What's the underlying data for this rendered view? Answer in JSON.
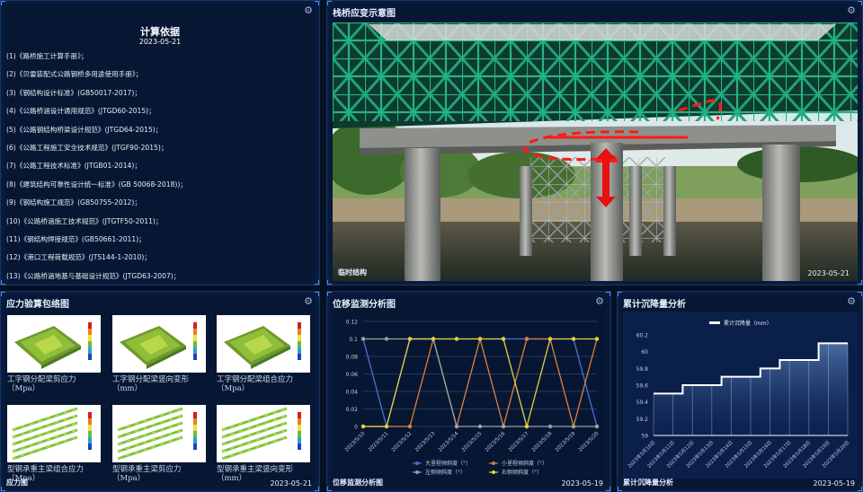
{
  "basis": {
    "title": "计算依据",
    "date": "2023-05-21",
    "items": [
      "(1)《路桥施工计算手册》；",
      "(2)《贝雷装配式公路钢桥多用途使用手册》；",
      "(3)《钢结构设计标准》(GB50017-2017)；",
      "(4)《公路桥涵设计通用规范》(JTGD60-2015)；",
      "(5)《公路钢结构桥梁设计规范》(JTGD64-2015)；",
      "(6)《公路工程施工安全技术规范》(JTGF90-2015)；",
      "(7)《公路工程技术标准》(JTGB01-2014)；",
      "(8)《建筑结构可靠性设计统一标准》(GB 50068-2018))；",
      "(9)《钢结构施工规范》(GB50755-2012)；",
      "(10)《公路桥涵施工技术规范》(JTGTF50-2011)；",
      "(11)《钢结构焊接规范》(GB50661-2011)；",
      "(12)《港口工程荷载规范》(JTS144-1-2010)；",
      "(13)《公路桥涵地基与基础设计规范》(JTGD63-2007)；"
    ]
  },
  "scheme": {
    "title": "栈桥应变示意图",
    "footer_label": "临时结构",
    "date": "2023-05-21",
    "colors": {
      "truss": "#1fa37a",
      "arrow": "#ff1a1a"
    }
  },
  "stress": {
    "title": "应力验算包络图",
    "footer_label": "应力图",
    "date": "2023-05-21",
    "thumbs": [
      {
        "caption_line1": "工字钢分配梁剪应力",
        "caption_line2": "（Mpa）",
        "style": "plate"
      },
      {
        "caption_line1": "工字钢分配梁竖向变形",
        "caption_line2": "（mm）",
        "style": "plate"
      },
      {
        "caption_line1": "工字钢分配梁组合应力",
        "caption_line2": "（Mpa）",
        "style": "plate"
      },
      {
        "caption_line1": "型钢承重主梁组合应力",
        "caption_line2": "（Mpa）",
        "style": "beams"
      },
      {
        "caption_line1": "型钢承重主梁剪应力",
        "caption_line2": "（Mpa）",
        "style": "beams"
      },
      {
        "caption_line1": "型钢承重主梁竖向变形",
        "caption_line2": "（mm）",
        "style": "beams"
      }
    ]
  },
  "displacement": {
    "title": "位移监测分析图",
    "footer_label": "位移监测分析图",
    "date": "2023-05-19",
    "chart_data": {
      "type": "line",
      "x": [
        "2023/5/10",
        "2023/5/11",
        "2023/5/12",
        "2023/5/13",
        "2023/5/14",
        "2023/5/15",
        "2023/5/16",
        "2023/5/17",
        "2023/5/18",
        "2023/5/19",
        "2023/5/20"
      ],
      "ylim": [
        0,
        0.12
      ],
      "yticks": [
        0,
        0.02,
        0.04,
        0.06,
        0.08,
        0.1,
        0.12
      ],
      "grid": true,
      "legend_position": "bottom",
      "series": [
        {
          "name": "大里程倾斜度（°）",
          "color": "#4a6fd8",
          "values": [
            0.1,
            0,
            0.1,
            0.1,
            0.1,
            0.1,
            0.1,
            0.1,
            0.1,
            0.1,
            0
          ]
        },
        {
          "name": "小里程倾斜度（°）",
          "color": "#e0803a",
          "values": [
            0,
            0,
            0,
            0.1,
            0,
            0.1,
            0,
            0.1,
            0.1,
            0,
            0.1
          ]
        },
        {
          "name": "左侧倾斜度（°）",
          "color": "#a0a0a0",
          "values": [
            0.1,
            0.1,
            0.1,
            0.1,
            0,
            0,
            0,
            0,
            0,
            0,
            0
          ]
        },
        {
          "name": "右侧倾斜度（°）",
          "color": "#e8d040",
          "values": [
            0,
            0,
            0.1,
            0.1,
            0.1,
            0.1,
            0.1,
            0,
            0.1,
            0.1,
            0.1
          ]
        }
      ]
    }
  },
  "settlement": {
    "title": "累计沉降量分析",
    "footer_label": "累计沉降量分析",
    "date": "2023-05-19",
    "chart_data": {
      "type": "area",
      "x": [
        "2023年5月10日",
        "2023年5月11日",
        "2023年5月12日",
        "2023年5月13日",
        "2023年5月14日",
        "2023年5月15日",
        "2023年5月16日",
        "2023年5月17日",
        "2023年5月18日",
        "2023年5月19日",
        "2023年5月20日"
      ],
      "ylim": [
        59,
        60.2
      ],
      "yticks": [
        59,
        59.2,
        59.4,
        59.6,
        59.8,
        60,
        60.2
      ],
      "grid": false,
      "legend_position": "top",
      "series": [
        {
          "name": "累计沉降量（mm）",
          "color": "#ffffff",
          "values": [
            59.5,
            59.5,
            59.6,
            59.6,
            59.7,
            59.7,
            59.8,
            59.9,
            59.9,
            60.1,
            60.1
          ]
        }
      ]
    }
  }
}
